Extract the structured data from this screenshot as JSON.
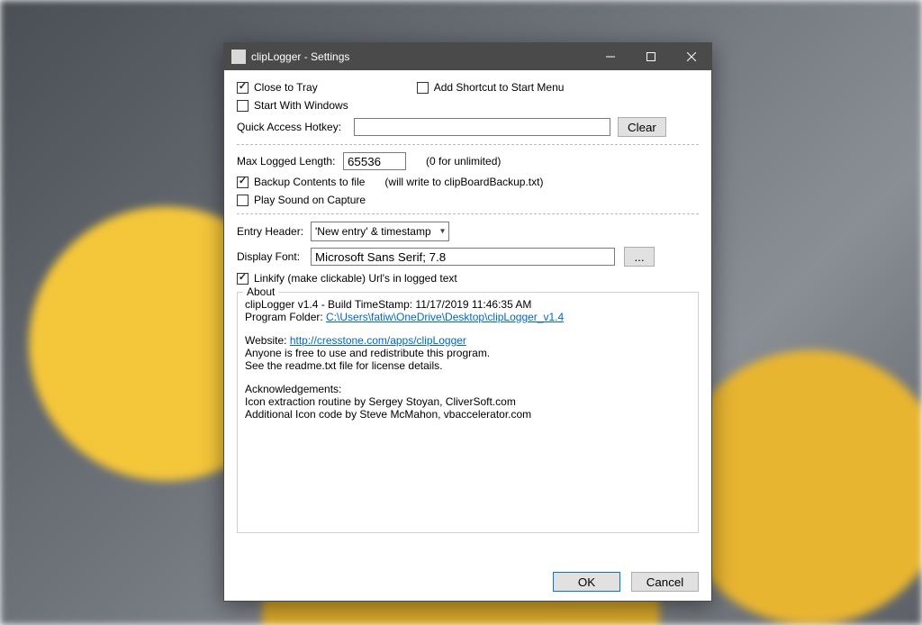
{
  "window": {
    "title": "clipLogger - Settings"
  },
  "checks": {
    "close_to_tray": {
      "label": "Close to Tray",
      "checked": true
    },
    "add_shortcut": {
      "label": "Add Shortcut to Start Menu",
      "checked": false
    },
    "start_with_win": {
      "label": "Start With Windows",
      "checked": false
    },
    "backup": {
      "label": "Backup Contents to file",
      "checked": true
    },
    "play_sound": {
      "label": "Play Sound on Capture",
      "checked": false
    },
    "linkify": {
      "label": "Linkify (make clickable) Url's in logged text",
      "checked": true
    }
  },
  "hotkey": {
    "label": "Quick Access Hotkey:",
    "value": "",
    "clear": "Clear"
  },
  "maxlen": {
    "label": "Max Logged Length:",
    "value": "65536",
    "hint": "(0 for unlimited)"
  },
  "backup_hint": "(will write to clipBoardBackup.txt)",
  "entry_header": {
    "label": "Entry Header:",
    "value": "'New entry' & timestamp"
  },
  "display_font": {
    "label": "Display Font:",
    "value": "Microsoft Sans Serif; 7.8",
    "browse": "..."
  },
  "about": {
    "legend": "About",
    "line1": "clipLogger v1.4   -   Build TimeStamp: 11/17/2019 11:46:35 AM",
    "folder_label": "Program Folder: ",
    "folder_link": "C:\\Users\\fatiw\\OneDrive\\Desktop\\clipLogger_v1.4",
    "website_label": "Website: ",
    "website_link": "http://cresstone.com/apps/clipLogger",
    "redistribute": "Anyone is free to use and redistribute this program.",
    "readme": "See the readme.txt file for license details.",
    "ack_head": "Acknowledgements:",
    "ack1": "Icon extraction routine by Sergey Stoyan, CliverSoft.com",
    "ack2": "Additional Icon code by Steve McMahon, vbaccelerator.com"
  },
  "footer": {
    "ok": "OK",
    "cancel": "Cancel"
  }
}
